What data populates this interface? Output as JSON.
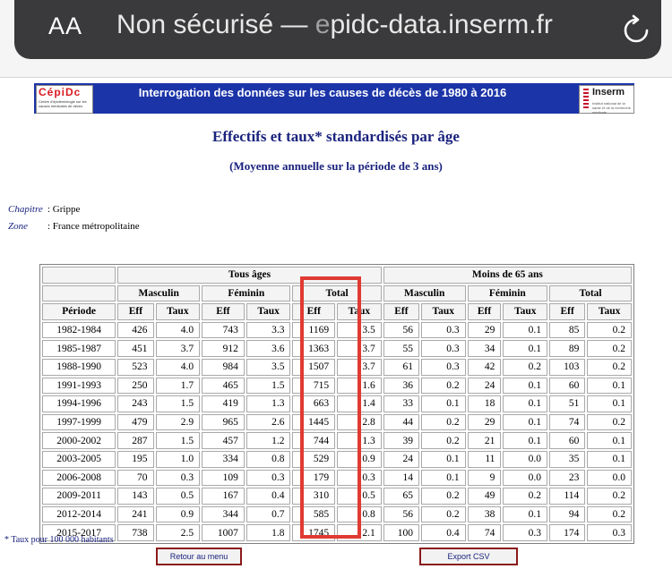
{
  "browser": {
    "text_size_label": "AA",
    "security_label": "Non sécurisé —",
    "url_fragment_faded": "e",
    "url_domain": "pidc-data.inserm.fr",
    "reload_icon": "reload-icon"
  },
  "banner": {
    "logo_left": "CépiDc",
    "logo_left_sub": "Centre d'épidémiologie sur les causes médicales de décès",
    "title": "Interrogation des données sur les causes de décès de 1980 à 2016",
    "logo_right": "Inserm",
    "logo_right_sub": "Institut national de la santé et de la recherche médicale",
    "color": "#1b34a8"
  },
  "page": {
    "title": "Effectifs et taux* standardisés par âge",
    "subtitle": "(Moyenne annuelle sur la période de 3 ans)",
    "chapitre_label": "Chapitre",
    "chapitre_value": ": Grippe",
    "zone_label": "Zone",
    "zone_value": ": France métropolitaine"
  },
  "table": {
    "group_all": "Tous âges",
    "group_under65": "Moins de 65 ans",
    "masculin": "Masculin",
    "feminin": "Féminin",
    "total": "Total",
    "periode": "Période",
    "eff": "Eff",
    "taux": "Taux",
    "rows": [
      [
        "1982-1984",
        "426",
        "4.0",
        "743",
        "3.3",
        "1169",
        "3.5",
        "56",
        "0.3",
        "29",
        "0.1",
        "85",
        "0.2"
      ],
      [
        "1985-1987",
        "451",
        "3.7",
        "912",
        "3.6",
        "1363",
        "3.7",
        "55",
        "0.3",
        "34",
        "0.1",
        "89",
        "0.2"
      ],
      [
        "1988-1990",
        "523",
        "4.0",
        "984",
        "3.5",
        "1507",
        "3.7",
        "61",
        "0.3",
        "42",
        "0.2",
        "103",
        "0.2"
      ],
      [
        "1991-1993",
        "250",
        "1.7",
        "465",
        "1.5",
        "715",
        "1.6",
        "36",
        "0.2",
        "24",
        "0.1",
        "60",
        "0.1"
      ],
      [
        "1994-1996",
        "243",
        "1.5",
        "419",
        "1.3",
        "663",
        "1.4",
        "33",
        "0.1",
        "18",
        "0.1",
        "51",
        "0.1"
      ],
      [
        "1997-1999",
        "479",
        "2.9",
        "965",
        "2.6",
        "1445",
        "2.8",
        "44",
        "0.2",
        "29",
        "0.1",
        "74",
        "0.2"
      ],
      [
        "2000-2002",
        "287",
        "1.5",
        "457",
        "1.2",
        "744",
        "1.3",
        "39",
        "0.2",
        "21",
        "0.1",
        "60",
        "0.1"
      ],
      [
        "2003-2005",
        "195",
        "1.0",
        "334",
        "0.8",
        "529",
        "0.9",
        "24",
        "0.1",
        "11",
        "0.0",
        "35",
        "0.1"
      ],
      [
        "2006-2008",
        "70",
        "0.3",
        "109",
        "0.3",
        "179",
        "0.3",
        "14",
        "0.1",
        "9",
        "0.0",
        "23",
        "0.0"
      ],
      [
        "2009-2011",
        "143",
        "0.5",
        "167",
        "0.4",
        "310",
        "0.5",
        "65",
        "0.2",
        "49",
        "0.2",
        "114",
        "0.2"
      ],
      [
        "2012-2014",
        "241",
        "0.9",
        "344",
        "0.7",
        "585",
        "0.8",
        "56",
        "0.2",
        "38",
        "0.1",
        "94",
        "0.2"
      ],
      [
        "2015-2017",
        "738",
        "2.5",
        "1007",
        "1.8",
        "1745",
        "2.1",
        "100",
        "0.4",
        "74",
        "0.3",
        "174",
        "0.3"
      ]
    ]
  },
  "footnote": "* Taux pour 100 000 habitants",
  "buttons": {
    "menu": "Retour au menu",
    "csv": "Export CSV"
  },
  "highlight_color": "#e03a32"
}
